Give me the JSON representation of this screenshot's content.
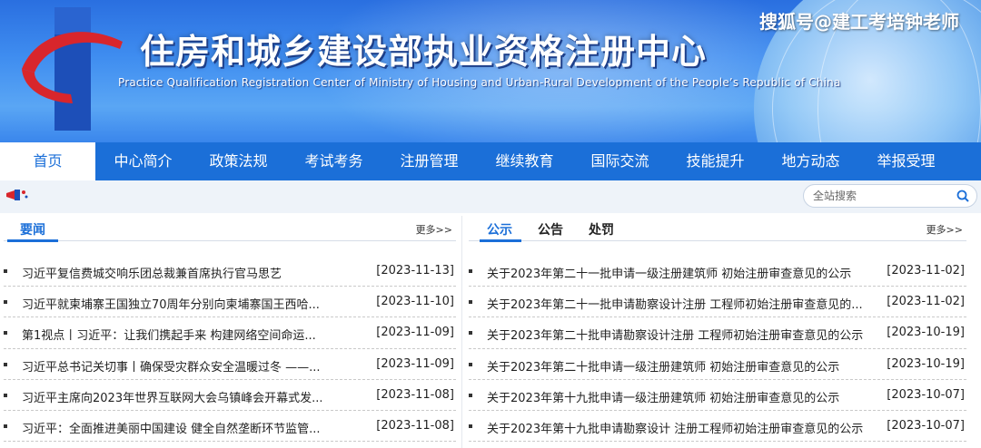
{
  "header": {
    "title": "住房和城乡建设部执业资格注册中心",
    "subtitle": "Practice Qualification Registration Center of Ministry of Housing and Urban-Rural Development of the People’s Republic of China",
    "watermark": "搜狐号@建工考培钟老师"
  },
  "nav": {
    "items": [
      {
        "label": "首页",
        "active": true
      },
      {
        "label": "中心简介"
      },
      {
        "label": "政策法规"
      },
      {
        "label": "考试考务"
      },
      {
        "label": "注册管理"
      },
      {
        "label": "继续教育"
      },
      {
        "label": "国际交流"
      },
      {
        "label": "技能提升"
      },
      {
        "label": "地方动态"
      },
      {
        "label": "举报受理"
      }
    ]
  },
  "search": {
    "placeholder": "全站搜索",
    "icon": "search-icon"
  },
  "news": {
    "tab": "要闻",
    "more": "更多>>",
    "items": [
      {
        "title": "习近平复信费城交响乐团总裁兼首席执行官马思艺",
        "date": "[2023-11-13]"
      },
      {
        "title": "习近平就柬埔寨王国独立70周年分别向柬埔寨国王西哈...",
        "date": "[2023-11-10]"
      },
      {
        "title": "第1视点丨习近平：让我们携起手来 构建网络空间命运...",
        "date": "[2023-11-09]"
      },
      {
        "title": "习近平总书记关切事丨确保受灾群众安全温暖过冬 ——...",
        "date": "[2023-11-09]"
      },
      {
        "title": "习近平主席向2023年世界互联网大会乌镇峰会开幕式发...",
        "date": "[2023-11-08]"
      },
      {
        "title": "习近平：全面推进美丽中国建设 健全自然垄断环节监管...",
        "date": "[2023-11-08]"
      }
    ]
  },
  "notices": {
    "tabs": [
      "公示",
      "公告",
      "处罚"
    ],
    "more": "更多>>",
    "items": [
      {
        "title": "关于2023年第二十一批申请一级注册建筑师 初始注册审查意见的公示",
        "date": "[2023-11-02]"
      },
      {
        "title": "关于2023年第二十一批申请勘察设计注册 工程师初始注册审查意见的...",
        "date": "[2023-11-02]"
      },
      {
        "title": "关于2023年第二十批申请勘察设计注册 工程师初始注册审查意见的公示",
        "date": "[2023-10-19]"
      },
      {
        "title": "关于2023年第二十批申请一级注册建筑师 初始注册审查意见的公示",
        "date": "[2023-10-19]"
      },
      {
        "title": "关于2023年第十九批申请一级注册建筑师 初始注册审查意见的公示",
        "date": "[2023-10-07]"
      },
      {
        "title": "关于2023年第十九批申请勘察设计 注册工程师初始注册审查意见的公示",
        "date": "[2023-10-07]"
      }
    ]
  },
  "colors": {
    "primary": "#1b6fd8",
    "accent_red": "#d8262c"
  }
}
